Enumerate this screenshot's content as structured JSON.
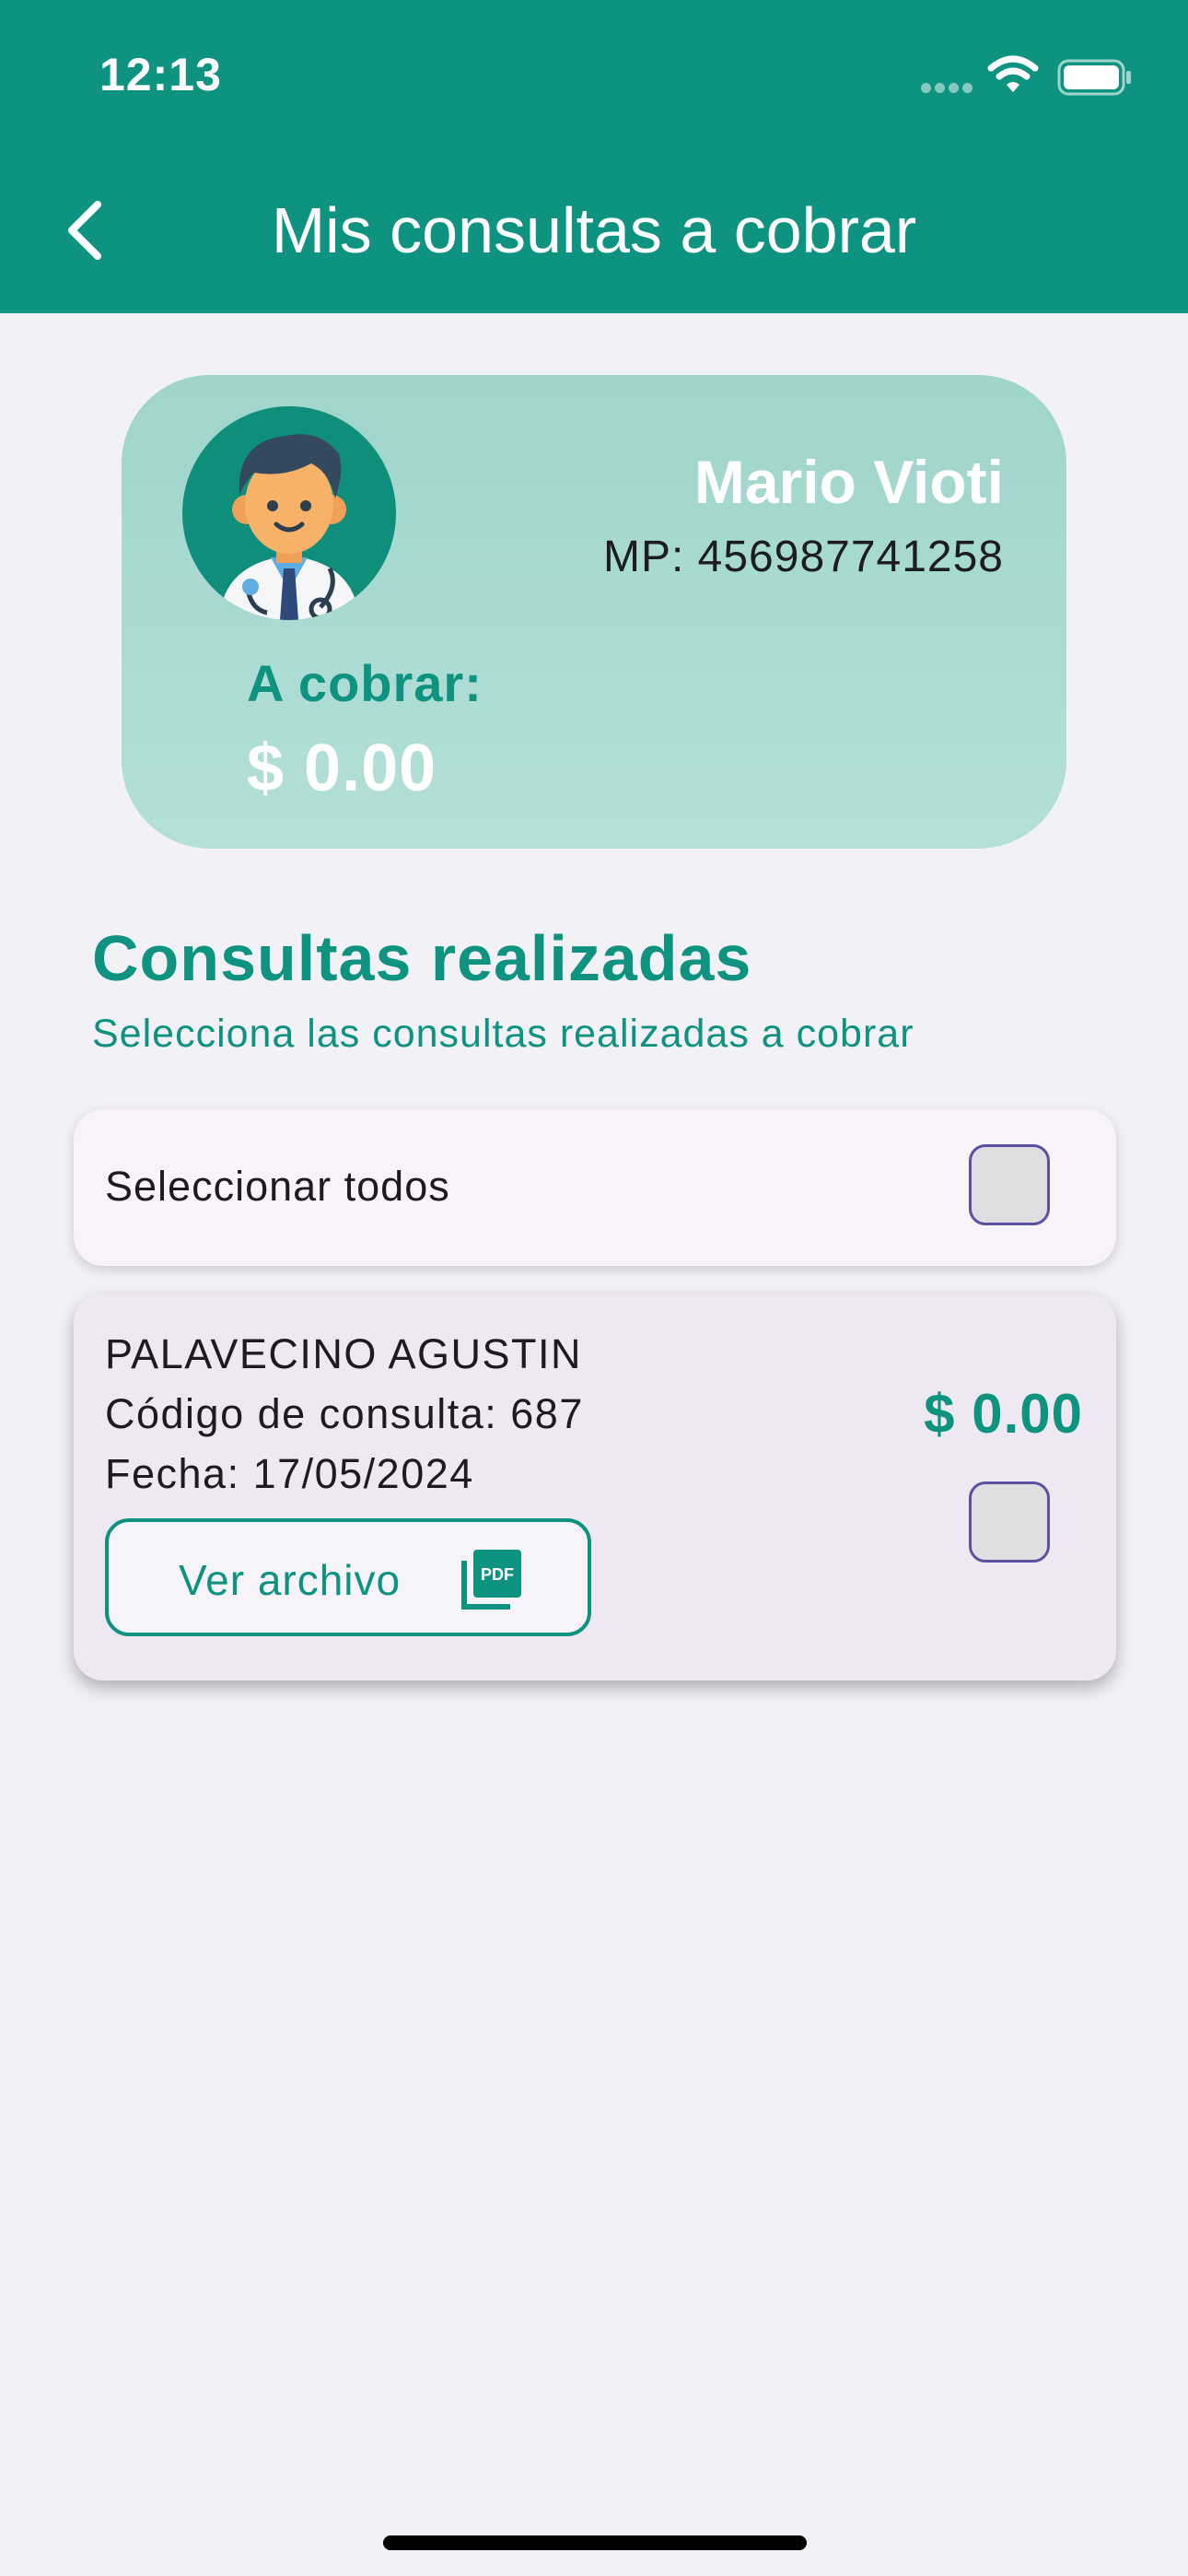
{
  "status_bar": {
    "time": "12:13"
  },
  "app_bar": {
    "title": "Mis consultas a cobrar"
  },
  "profile": {
    "name": "Mario Vioti",
    "mp": "MP: 456987741258",
    "cobrar_label": "A cobrar:",
    "cobrar_value": "$ 0.00"
  },
  "section": {
    "title": "Consultas realizadas",
    "subtitle": "Selecciona las consultas realizadas a cobrar"
  },
  "select_all": {
    "label": "Seleccionar todos",
    "checked": false
  },
  "consultas": [
    {
      "patient": "PALAVECINO AGUSTIN",
      "codigo": "Código de consulta: 687",
      "fecha": "Fecha: 17/05/2024",
      "amount": "$ 0.00",
      "button_label": "Ver archivo",
      "checked": false
    }
  ],
  "colors": {
    "primary": "#0e9380",
    "card_bg": "#a6d8cf",
    "background": "#f2f1f6",
    "checkbox_border": "#5a52a0"
  },
  "icons": [
    "back-chevron-icon",
    "wifi-icon",
    "battery-icon",
    "doctor-avatar",
    "pdf-icon"
  ]
}
